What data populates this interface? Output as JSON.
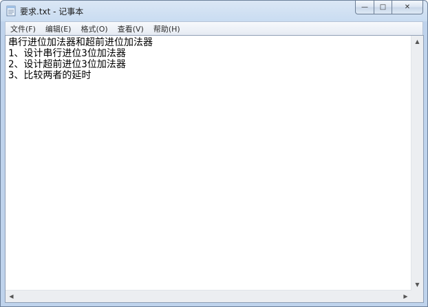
{
  "window": {
    "title": "要求.txt - 记事本",
    "icon": "notepad-icon",
    "controls": {
      "minimize": "—",
      "maximize": "□",
      "close": "✕"
    }
  },
  "menu": [
    {
      "label": "文件(F)"
    },
    {
      "label": "编辑(E)"
    },
    {
      "label": "格式(O)"
    },
    {
      "label": "查看(V)"
    },
    {
      "label": "帮助(H)"
    }
  ],
  "document": {
    "lines": [
      "串行进位加法器和超前进位加法器",
      "1、设计串行进位3位加法器",
      "2、设计超前进位3位加法器",
      "3、比较两者的延时"
    ]
  },
  "scrollbars": {
    "up": "▲",
    "down": "▼",
    "left": "◀",
    "right": "▶"
  }
}
